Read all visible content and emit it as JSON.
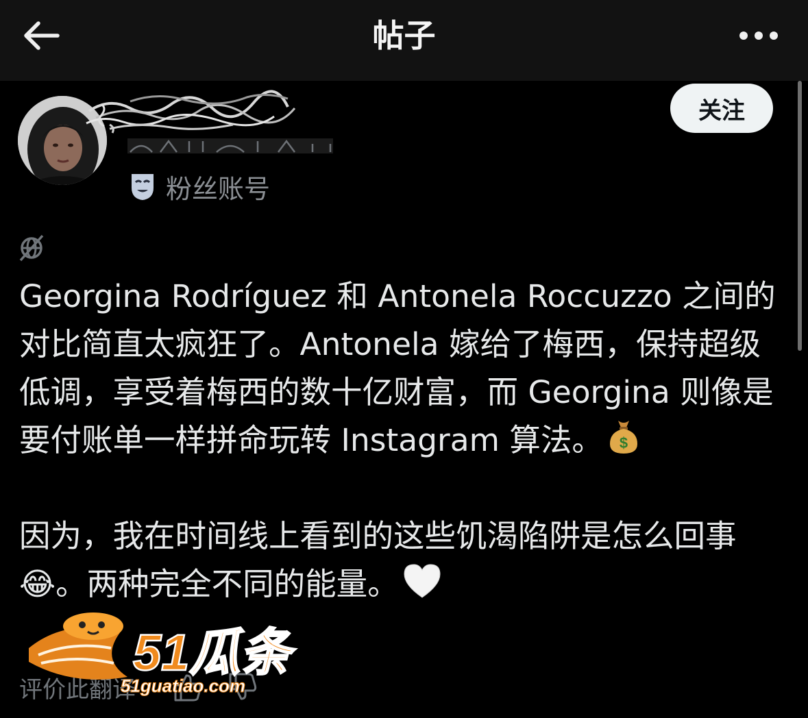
{
  "header": {
    "title": "帖子",
    "back_icon": "arrow-left-icon",
    "more_icon": "more-horizontal-icon"
  },
  "author": {
    "account_label": "粉丝账号",
    "account_label_icon": "theater-mask-icon",
    "follow_label": "关注"
  },
  "post": {
    "globe_icon": "globe-icon",
    "paragraphs": [
      "Georgina Rodríguez 和 Antonela Roccuzzo 之间的对比简直太疯狂了。Antonela 嫁给了梅西，保持超级低调，享受着梅西的数十亿财富，而 Georgina 则像是要付账单一样拼命玩转 Instagram 算法。",
      "因为，我在时间线上看到的这些饥渴陷阱是怎么回事😂。两种完全不同的能量。"
    ],
    "emojis": [
      "money-bag-emoji",
      "white-heart-emoji"
    ]
  },
  "translation": {
    "rate_label": "评价此翻译"
  },
  "watermark": {
    "brand": "51瓜条",
    "url": "51guatiao.com"
  },
  "colors": {
    "background": "#000000",
    "header_bg": "#121212",
    "text": "#e7e9ea",
    "secondary_text": "#71767b",
    "follow_bg": "#eff3f4",
    "watermark_orange": "#f08a1d"
  }
}
